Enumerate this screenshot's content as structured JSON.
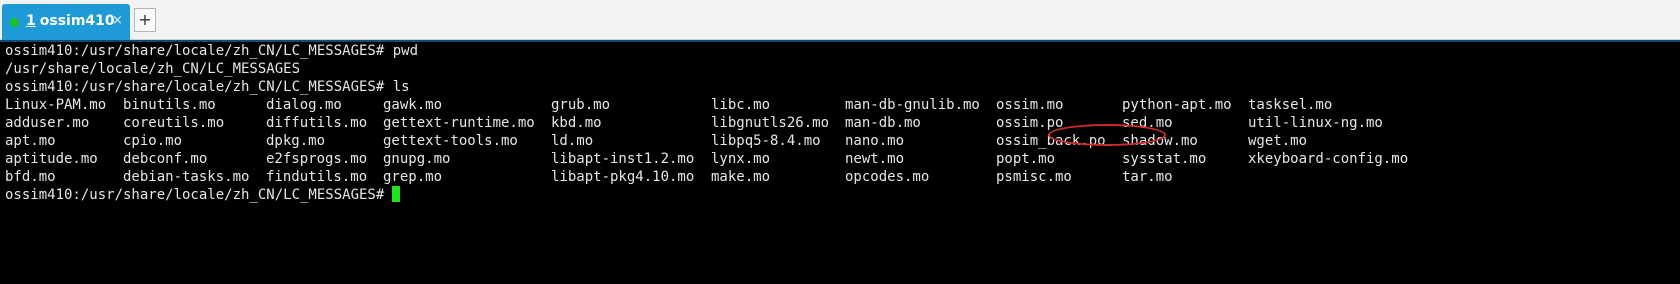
{
  "tab": {
    "number": "1",
    "title": "ossim410",
    "close_glyph": "×",
    "new_tab_glyph": "+"
  },
  "terminal": {
    "lines": [
      "ossim410:/usr/share/locale/zh_CN/LC_MESSAGES# pwd",
      "/usr/share/locale/zh_CN/LC_MESSAGES",
      "ossim410:/usr/share/locale/zh_CN/LC_MESSAGES# ls"
    ],
    "ls_rows": [
      [
        "Linux-PAM.mo",
        "binutils.mo",
        "dialog.mo",
        "gawk.mo",
        "grub.mo",
        "libc.mo",
        "man-db-gnulib.mo",
        "ossim.mo",
        "python-apt.mo",
        "tasksel.mo"
      ],
      [
        "adduser.mo",
        "coreutils.mo",
        "diffutils.mo",
        "gettext-runtime.mo",
        "kbd.mo",
        "libgnutls26.mo",
        "man-db.mo",
        "ossim.po",
        "sed.mo",
        "util-linux-ng.mo"
      ],
      [
        "apt.mo",
        "cpio.mo",
        "dpkg.mo",
        "gettext-tools.mo",
        "ld.mo",
        "libpq5-8.4.mo",
        "nano.mo",
        "ossim_back.po",
        "shadow.mo",
        "wget.mo"
      ],
      [
        "aptitude.mo",
        "debconf.mo",
        "e2fsprogs.mo",
        "gnupg.mo",
        "libapt-inst1.2.mo",
        "lynx.mo",
        "newt.mo",
        "popt.mo",
        "sysstat.mo",
        "xkeyboard-config.mo"
      ],
      [
        "bfd.mo",
        "debian-tasks.mo",
        "findutils.mo",
        "grep.mo",
        "libapt-pkg4.10.mo",
        "make.mo",
        "opcodes.mo",
        "psmisc.mo",
        "tar.mo",
        ""
      ]
    ],
    "prompt": "ossim410:/usr/share/locale/zh_CN/LC_MESSAGES#"
  },
  "colors": {
    "tab_active": "#1e9bd7",
    "status_dot": "#23c023",
    "terminal_bg": "#000000",
    "terminal_text": "#e6e6e6",
    "cursor": "#1ee61e",
    "annotation": "#d22b2b"
  }
}
